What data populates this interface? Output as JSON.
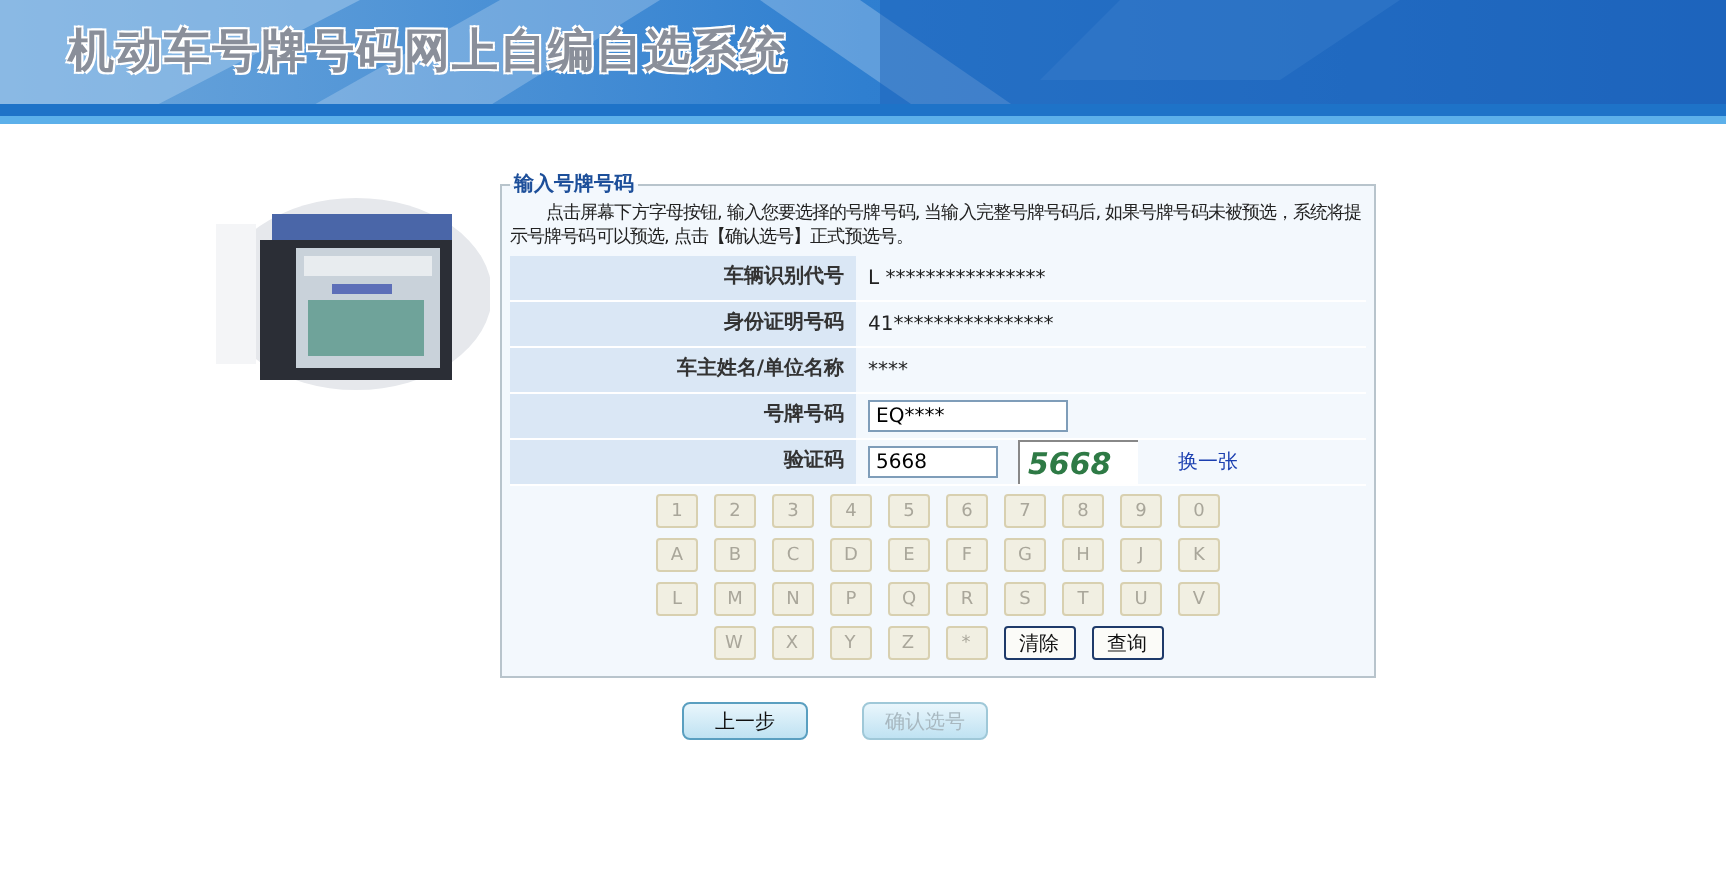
{
  "banner": {
    "title": "机动车号牌号码网上自编自选系统"
  },
  "panel": {
    "legend": "输入号牌号码",
    "intro": "点击屏幕下方字母按钮, 输入您要选择的号牌号码, 当输入完整号牌号码后, 如果号牌号码未被预选，系统将提示号牌号码可以预选, 点击【确认选号】正式预选号。"
  },
  "rows": [
    {
      "kind": "text",
      "label": "车辆识别代号",
      "value": "L ****************"
    },
    {
      "kind": "text",
      "label": "身份证明号码",
      "value": "41****************"
    },
    {
      "kind": "text",
      "label": "车主姓名/单位名称",
      "value": "****"
    },
    {
      "kind": "input",
      "label": "号牌号码",
      "value": "EQ****"
    },
    {
      "kind": "captcha",
      "label": "验证码",
      "value": "5668",
      "captcha_text": "5668",
      "refresh_link": "换一张"
    }
  ],
  "keys": [
    [
      {
        "label": "1",
        "disabled": true
      },
      {
        "label": "2",
        "disabled": true
      },
      {
        "label": "3",
        "disabled": true
      },
      {
        "label": "4",
        "disabled": true
      },
      {
        "label": "5",
        "disabled": true
      },
      {
        "label": "6",
        "disabled": true
      },
      {
        "label": "7",
        "disabled": true
      },
      {
        "label": "8",
        "disabled": true
      },
      {
        "label": "9",
        "disabled": true
      },
      {
        "label": "0",
        "disabled": true
      }
    ],
    [
      {
        "label": "A",
        "disabled": true
      },
      {
        "label": "B",
        "disabled": true
      },
      {
        "label": "C",
        "disabled": true
      },
      {
        "label": "D",
        "disabled": true
      },
      {
        "label": "E",
        "disabled": true
      },
      {
        "label": "F",
        "disabled": true
      },
      {
        "label": "G",
        "disabled": true
      },
      {
        "label": "H",
        "disabled": true
      },
      {
        "label": "J",
        "disabled": true
      },
      {
        "label": "K",
        "disabled": true
      }
    ],
    [
      {
        "label": "L",
        "disabled": true
      },
      {
        "label": "M",
        "disabled": true
      },
      {
        "label": "N",
        "disabled": true
      },
      {
        "label": "P",
        "disabled": true
      },
      {
        "label": "Q",
        "disabled": true
      },
      {
        "label": "R",
        "disabled": true
      },
      {
        "label": "S",
        "disabled": true
      },
      {
        "label": "T",
        "disabled": true
      },
      {
        "label": "U",
        "disabled": true
      },
      {
        "label": "V",
        "disabled": true
      }
    ],
    [
      {
        "label": "W",
        "disabled": true
      },
      {
        "label": "X",
        "disabled": true
      },
      {
        "label": "Y",
        "disabled": true
      },
      {
        "label": "Z",
        "disabled": true
      },
      {
        "label": "*",
        "disabled": true
      },
      {
        "label": "清除",
        "disabled": false
      },
      {
        "label": "查询",
        "disabled": false
      }
    ]
  ],
  "actions": [
    {
      "label": "上一步",
      "disabled": false
    },
    {
      "label": "确认选号",
      "disabled": true
    }
  ]
}
